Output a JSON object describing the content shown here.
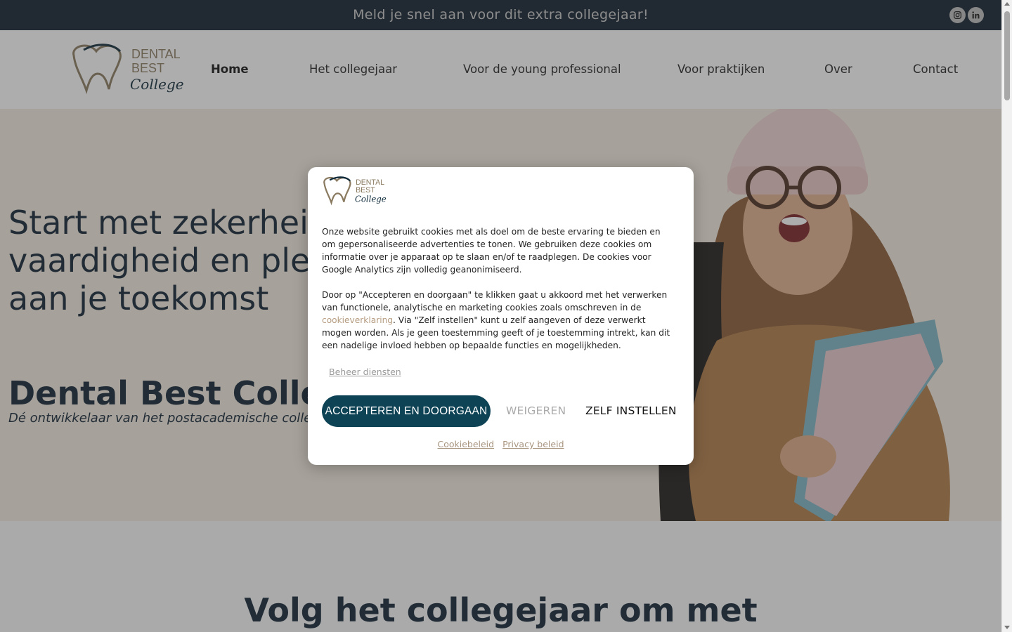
{
  "topbar": {
    "announcement": "Meld je snel aan voor dit extra collegejaar!",
    "social": [
      {
        "icon": "instagram-icon"
      },
      {
        "icon": "linkedin-icon"
      }
    ]
  },
  "logo": {
    "line1": "DENTAL",
    "line2": "BEST",
    "line3": "College"
  },
  "nav": {
    "items": [
      {
        "label": "Home",
        "active": true
      },
      {
        "label": "Het collegejaar"
      },
      {
        "label": "Voor de young professional"
      },
      {
        "label": "Voor praktijken"
      },
      {
        "label": "Over"
      },
      {
        "label": "Contact"
      }
    ]
  },
  "hero": {
    "title_lines": [
      "Start met zekerheid",
      "vaardigheid en plez",
      "aan je toekomst"
    ],
    "brand": "Dental Best College",
    "subtitle": "Dé ontwikkelaar van het postacademische colle"
  },
  "section2": {
    "title": "Volg het collegejaar om met"
  },
  "cookie": {
    "paragraph1": "Onze website gebruikt cookies met als doel om de beste ervaring te bieden en om gepersonaliseerde advertenties te tonen. We gebruiken deze cookies om informatie over je apparaat op te slaan en/of te raadplegen. De cookies voor Google Analytics zijn volledig geanonimiseerd.",
    "paragraph2_before": "Door op \"Accepteren en doorgaan\" te klikken gaat u akkoord met het verwerken van functionele, analytische en marketing cookies zoals omschreven in de ",
    "paragraph2_link": "cookieverklaring",
    "paragraph2_after": ". Via \"Zelf instellen\" kunt u zelf aangeven of deze verwerkt mogen worden. Als je geen toestemming geeft of je toestemming intrekt, kan dit een nadelige invloed hebben op bepaalde functies en mogelijkheden.",
    "manage_label": "Beheer diensten",
    "accept_label": "ACCEPTEREN EN DOORGAAN",
    "deny_label": "WEIGEREN",
    "custom_label": "ZELF INSTELLEN",
    "footer_links": [
      "Cookiebeleid",
      "Privacy beleid"
    ]
  },
  "colors": {
    "topbar_bg": "#0e1d2b",
    "accent": "#0e4356",
    "link": "#b59c80",
    "hero_bg": "#f3eadf",
    "text_dark": "#0e2233"
  }
}
